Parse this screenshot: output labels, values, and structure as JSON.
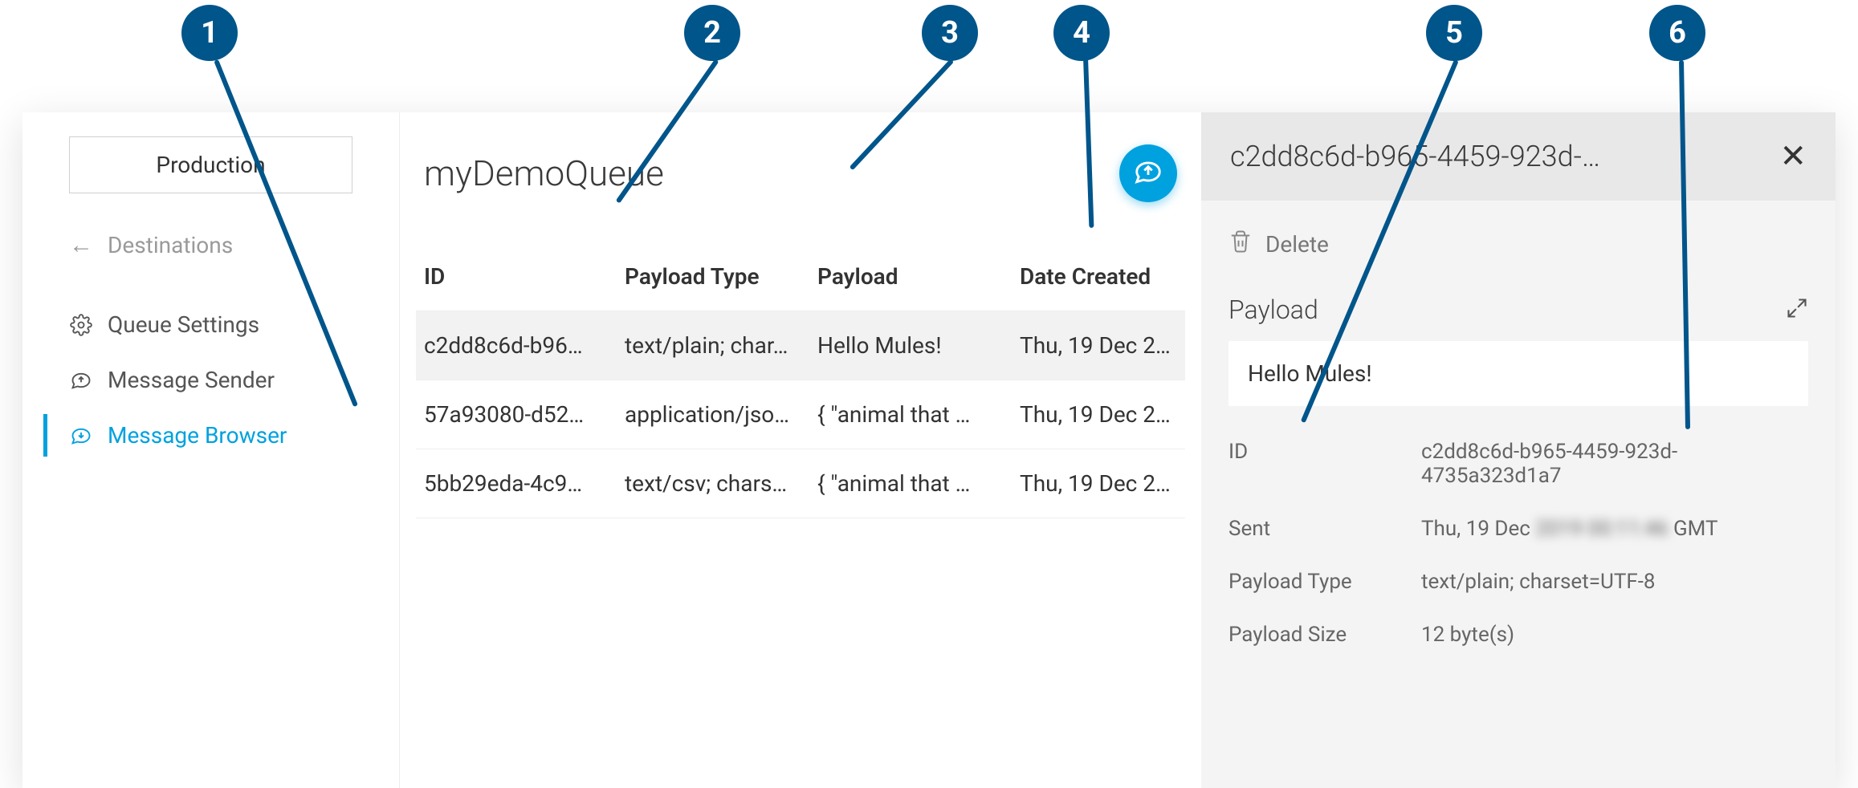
{
  "callouts": [
    "1",
    "2",
    "3",
    "4",
    "5",
    "6"
  ],
  "sidebar": {
    "env_label": "Production",
    "back_label": "Destinations",
    "items": [
      {
        "label": "Queue Settings"
      },
      {
        "label": "Message Sender"
      },
      {
        "label": "Message Browser"
      }
    ]
  },
  "queue": {
    "title": "myDemoQueue",
    "columns": {
      "id": "ID",
      "type": "Payload Type",
      "payload": "Payload",
      "date": "Date Created"
    },
    "rows": [
      {
        "id": "c2dd8c6d-b96…",
        "type": "text/plain; char…",
        "payload": "Hello Mules!",
        "date": "Thu, 19 Dec 20…"
      },
      {
        "id": "57a93080-d52…",
        "type": "application/jso…",
        "payload": "{ \"animal that …",
        "date": "Thu, 19 Dec 20…"
      },
      {
        "id": "5bb29eda-4c9…",
        "type": "text/csv; chars…",
        "payload": "{ \"animal that …",
        "date": "Thu, 19 Dec 20…"
      }
    ]
  },
  "detail": {
    "title": "c2dd8c6d-b965-4459-923d-…",
    "delete_label": "Delete",
    "payload_section_label": "Payload",
    "payload_text": "Hello Mules!",
    "meta": {
      "id_key": "ID",
      "id_val": "c2dd8c6d-b965-4459-923d-4735a323d1a7",
      "sent_key": "Sent",
      "sent_prefix": "Thu, 19 Dec ",
      "sent_blur": "2019 00:11:46",
      "sent_suffix": " GMT",
      "type_key": "Payload Type",
      "type_val": "text/plain; charset=UTF-8",
      "size_key": "Payload Size",
      "size_val": "12 byte(s)"
    }
  }
}
